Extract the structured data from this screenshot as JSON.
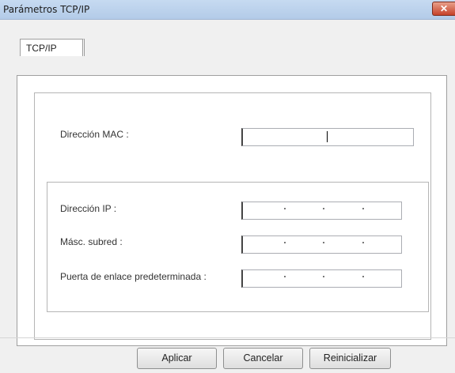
{
  "window": {
    "title": "Parámetros TCP/IP",
    "close_glyph": "✕"
  },
  "tabs": [
    {
      "label": "TCP/IP",
      "selected": true
    }
  ],
  "mac": {
    "label": "Dirección MAC :",
    "value": ""
  },
  "ip_group": {
    "ip_label": "Dirección IP :",
    "subnet_label": "Másc. subred :",
    "gateway_label": "Puerta de enlace predeterminada :"
  },
  "buttons": {
    "apply": "Aplicar",
    "cancel": "Cancelar",
    "reset": "Reinicializar"
  }
}
